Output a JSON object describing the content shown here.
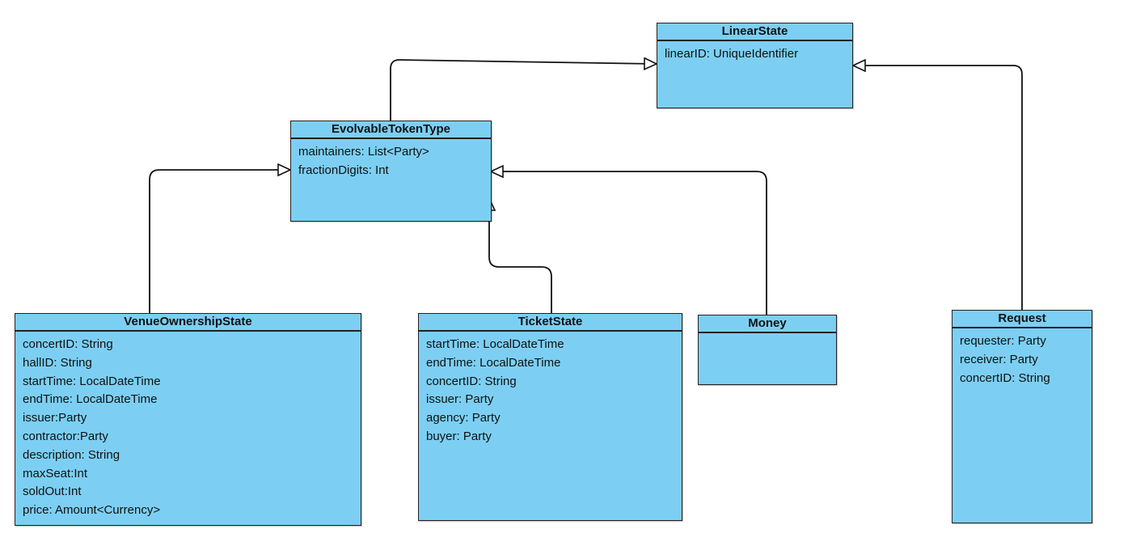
{
  "diagram": {
    "type": "uml-class-diagram",
    "classes": {
      "linear_state": {
        "name": "LinearState",
        "attributes": [
          "linearID: UniqueIdentifier"
        ]
      },
      "evolvable_token_type": {
        "name": "EvolvableTokenType",
        "attributes": [
          "maintainers: List<Party>",
          "fractionDigits: Int"
        ]
      },
      "venue_ownership_state": {
        "name": "VenueOwnershipState",
        "attributes": [
          "concertID: String",
          "hallID: String",
          "startTime: LocalDateTime",
          "endTime: LocalDateTime",
          "issuer:Party",
          "contractor:Party",
          "description: String",
          "maxSeat:Int",
          "soldOut:Int",
          "price: Amount<Currency>"
        ]
      },
      "ticket_state": {
        "name": "TicketState",
        "attributes": [
          "startTime: LocalDateTime",
          "endTime: LocalDateTime",
          "concertID: String",
          "issuer: Party",
          "agency: Party",
          "buyer: Party"
        ]
      },
      "money": {
        "name": "Money",
        "attributes": []
      },
      "request": {
        "name": "Request",
        "attributes": [
          "requester: Party",
          "receiver: Party",
          "concertID: String"
        ]
      }
    },
    "relationships": [
      {
        "type": "generalization",
        "from": "EvolvableTokenType",
        "to": "LinearState"
      },
      {
        "type": "generalization",
        "from": "Request",
        "to": "LinearState"
      },
      {
        "type": "generalization",
        "from": "VenueOwnershipState",
        "to": "EvolvableTokenType"
      },
      {
        "type": "generalization",
        "from": "TicketState",
        "to": "EvolvableTokenType"
      },
      {
        "type": "generalization",
        "from": "Money",
        "to": "EvolvableTokenType"
      }
    ],
    "colors": {
      "class_fill": "#7ccff3",
      "border": "#222222",
      "line": "#111111"
    }
  }
}
